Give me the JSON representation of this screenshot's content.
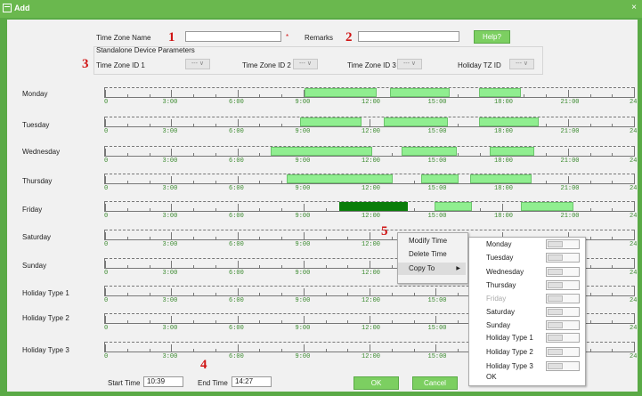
{
  "window": {
    "title": "Add",
    "close_label": "×"
  },
  "annotations": [
    "1",
    "2",
    "3",
    "4",
    "5"
  ],
  "form": {
    "time_zone_name_label": "Time Zone Name",
    "time_zone_name_value": "",
    "required_mark": "*",
    "remarks_label": "Remarks",
    "remarks_value": "",
    "help_button": "Help?",
    "standalone_label": "Standalone Device Parameters",
    "tz1_label": "Time Zone ID 1",
    "tz2_label": "Time Zone ID 2",
    "tz3_label": "Time Zone ID 3",
    "holiday_tz_label": "Holiday TZ ID",
    "select_placeholder": "--- ∨"
  },
  "axis_ticks": [
    "0",
    "3:00",
    "6:00",
    "9:00",
    "12:00",
    "15:00",
    "18:00",
    "21:00",
    "24"
  ],
  "rows": [
    {
      "label": "Monday",
      "segments": [
        [
          9.0,
          12.3
        ],
        [
          12.9,
          15.6
        ],
        [
          16.9,
          18.8
        ]
      ]
    },
    {
      "label": "Tuesday",
      "segments": [
        [
          8.8,
          11.6
        ],
        [
          12.6,
          15.5
        ],
        [
          16.9,
          19.6
        ]
      ]
    },
    {
      "label": "Wednesday",
      "segments": [
        [
          7.5,
          12.1
        ],
        [
          13.4,
          15.9
        ],
        [
          17.4,
          19.4
        ]
      ]
    },
    {
      "label": "Thursday",
      "segments": [
        [
          8.2,
          13.0
        ],
        [
          14.3,
          16.0
        ],
        [
          16.5,
          19.3
        ]
      ]
    },
    {
      "label": "Friday",
      "segments": [
        [
          10.6,
          13.7,
          "dark"
        ],
        [
          14.9,
          16.6
        ],
        [
          18.8,
          21.2
        ]
      ]
    },
    {
      "label": "Saturday",
      "segments": []
    },
    {
      "label": "Sunday",
      "segments": []
    },
    {
      "label": "Holiday Type 1",
      "segments": []
    },
    {
      "label": "Holiday Type 2",
      "segments": []
    },
    {
      "label": "Holiday Type 3",
      "segments": []
    }
  ],
  "footer": {
    "start_time_label": "Start Time",
    "start_time_value": "10:39",
    "end_time_label": "End Time",
    "end_time_value": "14:27",
    "ok_button": "OK",
    "cancel_button": "Cancel"
  },
  "context_menu": {
    "modify": "Modify Time",
    "delete": "Delete Time",
    "copy_to": "Copy To",
    "arrow": "▶"
  },
  "copy_submenu": {
    "items": [
      "Monday",
      "Tuesday",
      "Wednesday",
      "Thursday",
      "Friday",
      "Saturday",
      "Sunday",
      "Holiday Type 1",
      "Holiday Type 2",
      "Holiday Type 3"
    ],
    "disabled_item": "Friday",
    "ok": "OK"
  }
}
